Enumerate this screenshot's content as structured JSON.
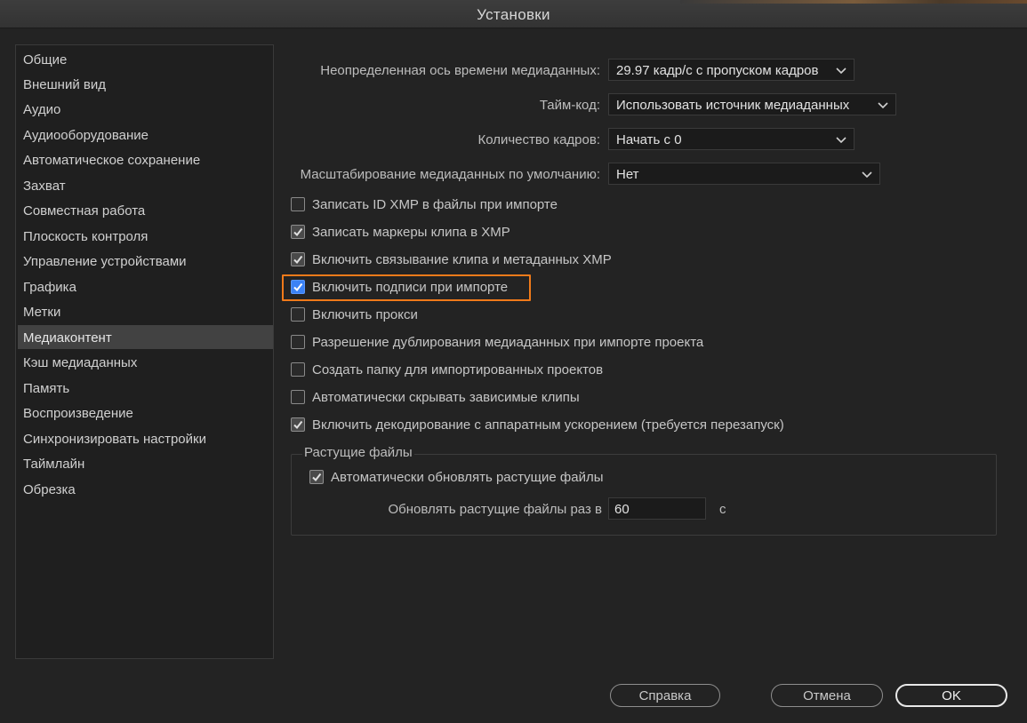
{
  "window": {
    "title": "Установки"
  },
  "sidebar": {
    "selected_index": 11,
    "items": [
      "Общие",
      "Внешний вид",
      "Аудио",
      "Аудиооборудование",
      "Автоматическое сохранение",
      "Захват",
      "Совместная работа",
      "Плоскость контроля",
      "Управление устройствами",
      "Графика",
      "Метки",
      "Медиаконтент",
      "Кэш медиаданных",
      "Память",
      "Воспроизведение",
      "Синхронизировать настройки",
      "Таймлайн",
      "Обрезка"
    ]
  },
  "settings": {
    "timebase": {
      "label": "Неопределенная ось времени медиаданных:",
      "value": "29.97 кадр/с с пропуском кадров"
    },
    "timecode": {
      "label": "Тайм-код:",
      "value": "Использовать источник медиаданных"
    },
    "frame_count": {
      "label": "Количество кадров:",
      "value": "Начать с 0"
    },
    "scaling": {
      "label": "Масштабирование медиаданных по умолчанию:",
      "value": "Нет"
    }
  },
  "checkboxes": [
    {
      "label": "Записать ID XMP в файлы при импорте",
      "checked": false
    },
    {
      "label": "Записать маркеры клипа в XMP",
      "checked": true
    },
    {
      "label": "Включить связывание клипа и метаданных XMP",
      "checked": true
    },
    {
      "label": "Включить подписи при импорте",
      "checked": true,
      "highlighted": true
    },
    {
      "label": "Включить прокси",
      "checked": false
    },
    {
      "label": "Разрешение дублирования медиаданных при импорте проекта",
      "checked": false
    },
    {
      "label": "Создать папку для импортированных проектов",
      "checked": false
    },
    {
      "label": "Автоматически скрывать зависимые клипы",
      "checked": false
    },
    {
      "label": "Включить декодирование с аппаратным ускорением (требуется перезапуск)",
      "checked": true
    }
  ],
  "growing_files": {
    "title": "Растущие файлы",
    "auto_refresh": {
      "label": "Автоматически обновлять растущие файлы",
      "checked": true
    },
    "interval": {
      "label": "Обновлять растущие файлы раз в",
      "value": "60",
      "unit": "с"
    }
  },
  "buttons": {
    "help": "Справка",
    "cancel": "Отмена",
    "ok": "OK"
  },
  "colors": {
    "highlight": "#f07a1a",
    "accent": "#3b82f6"
  }
}
